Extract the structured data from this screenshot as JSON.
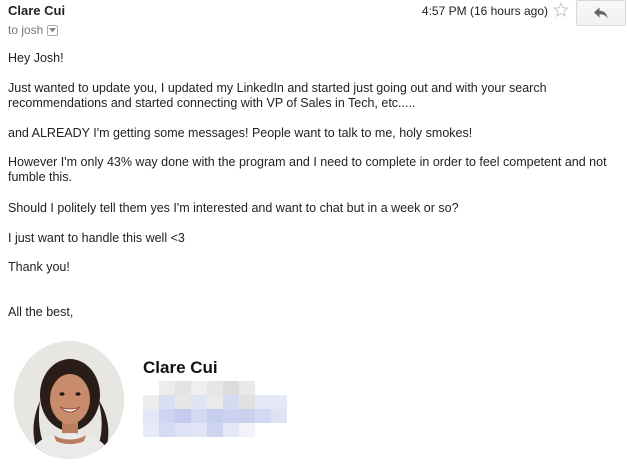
{
  "header": {
    "sender": "Clare Cui",
    "recipient": "to josh",
    "timestamp": "4:57 PM (16 hours ago)"
  },
  "body": {
    "greeting": "Hey Josh!",
    "paragraphs": [
      "Just wanted to update you, I updated my LinkedIn and started just going out and with your search recommendations and started connecting with VP of Sales in Tech, etc.....",
      "and ALREADY I'm getting some messages! People want to talk to me, holy smokes!",
      "However I'm only 43% way done with the program and I need to complete in order to feel competent and not fumble this.",
      "Should I politely tell them yes I'm interested and want to chat but in a week or so?",
      "I just want to handle this well <3",
      "Thank you!"
    ],
    "closing": "All the best,"
  },
  "signature": {
    "name": "Clare Cui",
    "photo_icon": "person-photo"
  },
  "icons": {
    "star": "star-icon",
    "reply": "reply-arrow-icon",
    "details": "chevron-down-icon"
  },
  "colors": {
    "text": "#222222",
    "muted": "#777777",
    "pixel_blue": "#c7d0ec",
    "pixel_gray": "#e6e6e6"
  }
}
